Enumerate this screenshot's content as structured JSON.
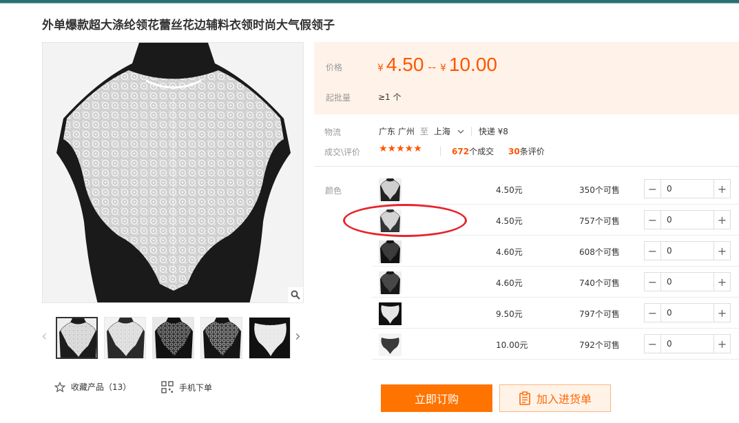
{
  "product": {
    "title": "外单爆款超大涤纶领花蕾丝花边辅料衣领时尚大气假领子"
  },
  "gallery": {
    "prev_arrow": "‹",
    "next_arrow": "›",
    "thumbnails": [
      {
        "variant": "white-on-gray-mannequin"
      },
      {
        "variant": "white-on-gray-mannequin"
      },
      {
        "variant": "black-white"
      },
      {
        "variant": "black-white"
      },
      {
        "variant": "white-flat"
      }
    ]
  },
  "actions": {
    "favorite_label": "收藏产品（13）",
    "mobile_order_label": "手机下单"
  },
  "pricing": {
    "price_label": "价格",
    "currency": "¥",
    "price_min": "4.50",
    "range_sep": "--",
    "price_max": "10.00",
    "moq_label": "起批量",
    "moq_value": "≥1 个"
  },
  "logistics": {
    "label": "物流",
    "from": "广东 广州",
    "to_word": "至",
    "destination": "上海",
    "shipping": "快递 ¥8"
  },
  "trade": {
    "label": "成交\\评价",
    "stars": "★★★★★",
    "deals_count": "672",
    "deals_suffix": "个成交",
    "reviews_count": "30",
    "reviews_suffix": "条评价"
  },
  "sku": {
    "color_label": "颜色",
    "rows": [
      {
        "price": "4.50元",
        "stock": "350个可售",
        "qty": "0",
        "variant": "gray-bg"
      },
      {
        "price": "4.50元",
        "stock": "757个可售",
        "qty": "0",
        "variant": "gray-bg"
      },
      {
        "price": "4.60元",
        "stock": "608个可售",
        "qty": "0",
        "variant": "black"
      },
      {
        "price": "4.60元",
        "stock": "740个可售",
        "qty": "0",
        "variant": "black"
      },
      {
        "price": "9.50元",
        "stock": "797个可售",
        "qty": "0",
        "variant": "white-flat"
      },
      {
        "price": "10.00元",
        "stock": "792个可售",
        "qty": "0",
        "variant": "dark-flat"
      }
    ]
  },
  "buttons": {
    "order_now": "立即订购",
    "add_to_list": "加入进货单"
  },
  "colors": {
    "accent": "#ff5500",
    "order_button": "#ff7300",
    "price_bg": "#fff2e8",
    "annotation_oval": "#e8232a",
    "top_bar": "#2e6e73"
  },
  "icons": {
    "zoom": "magnifier-icon",
    "favorite": "star-outline-icon",
    "mobile": "qr-code-icon",
    "dropdown": "chevron-down-icon",
    "cart": "clipboard-icon"
  }
}
